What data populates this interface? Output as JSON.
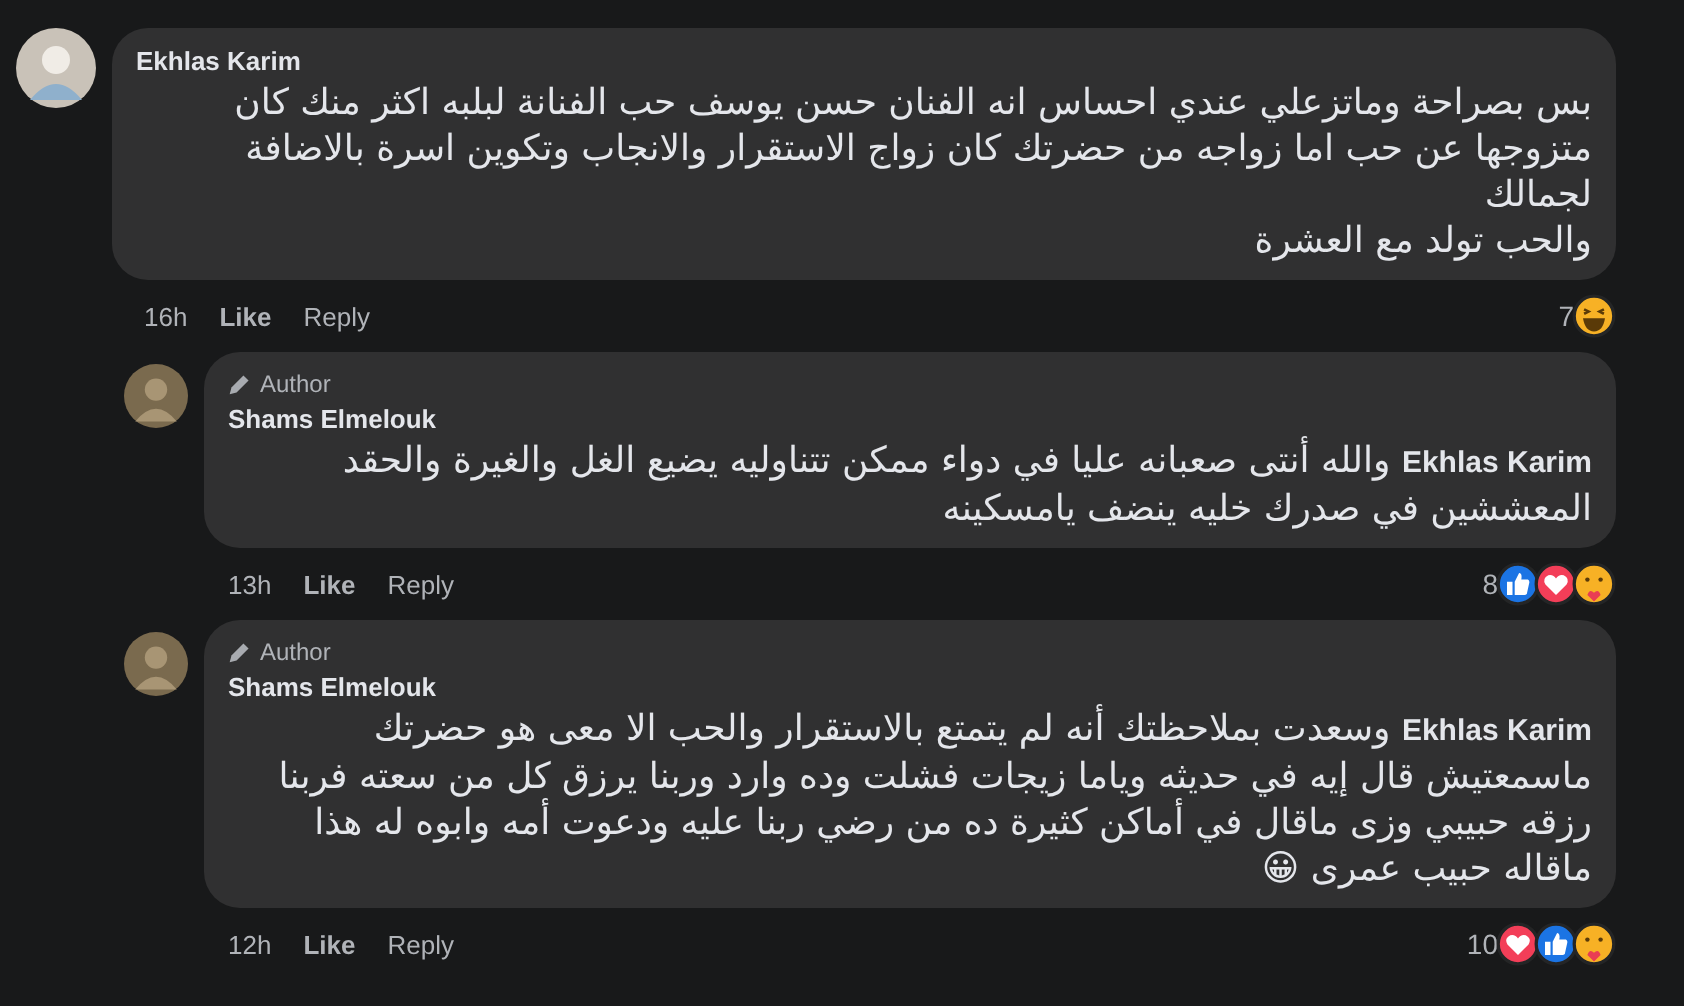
{
  "comments": [
    {
      "kind": "main",
      "author": "Ekhlas Karim",
      "lines": [
        "بس بصراحة وماتزعلي عندي احساس انه الفنان حسن يوسف حب الفنانة لبلبه اكثر منك كان",
        "متزوجها عن حب اما زواجه من حضرتك كان زواج الاستقرار والانجاب وتكوين اسرة بالاضافة لجمالك",
        "والحب تولد مع العشرة"
      ],
      "time": "16h",
      "like": "Like",
      "reply": "Reply",
      "reaction_count": "7",
      "reactions": [
        {
          "kind": "haha"
        }
      ]
    },
    {
      "kind": "reply",
      "author": "Shams Elmelouk",
      "author_badge": "Author",
      "lines": [
        "**Ekhlas Karim** والله أنتى صعبانه عليا في دواء ممكن تتناوليه يضيع الغل والغيرة والحقد",
        "المعششين في صدرك خليه ينضف يامسكينه"
      ],
      "time": "13h",
      "like": "Like",
      "reply": "Reply",
      "reaction_count": "8",
      "reactions": [
        {
          "kind": "like"
        },
        {
          "kind": "love"
        },
        {
          "kind": "care"
        }
      ]
    },
    {
      "kind": "reply",
      "author": "Shams Elmelouk",
      "author_badge": "Author",
      "lines": [
        "**Ekhlas Karim** وسعدت بملاحظتك أنه لم يتمتع بالاستقرار والحب الا معى هو حضرتك",
        "ماسمعتيش قال إيه في حديثه وياما زيجات فشلت وده وارد وربنا يرزق كل من سعته فربنا",
        "رزقه حبيبي وزى ماقال في أماكن كثيرة ده من رضي ربنا عليه ودعوت أمه وابوه له هذا",
        "ماقاله حبيب عمرى 😀"
      ],
      "time": "12h",
      "like": "Like",
      "reply": "Reply",
      "reaction_count": "10",
      "reactions": [
        {
          "kind": "love"
        },
        {
          "kind": "like"
        },
        {
          "kind": "care"
        }
      ]
    }
  ]
}
